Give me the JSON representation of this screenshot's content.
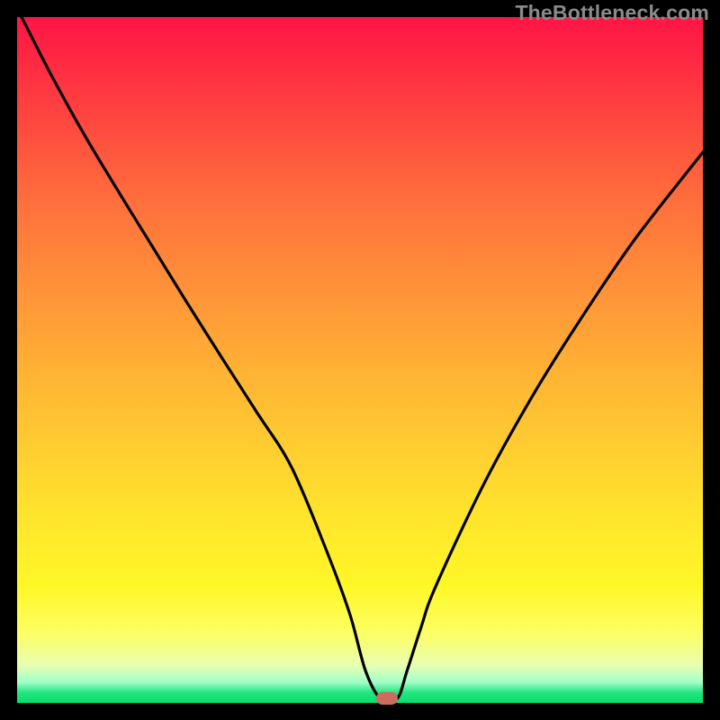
{
  "watermark": "TheBottleneck.com",
  "colors": {
    "frame": "#000000",
    "marker": "#cf6a5e",
    "curve": "#000000"
  },
  "chart_data": {
    "type": "line",
    "title": "",
    "xlabel": "",
    "ylabel": "",
    "xlim": [
      0,
      100
    ],
    "ylim": [
      0,
      100
    ],
    "grid": false,
    "legend": false,
    "series": [
      {
        "name": "bottleneck-curve",
        "x": [
          0.66,
          5,
          10,
          15,
          20,
          24.5,
          30,
          35,
          40,
          45,
          48.5,
          50.8,
          53.0,
          55.4,
          56.9,
          58.9,
          61,
          68,
          75,
          82,
          90,
          100
        ],
        "values": [
          100,
          91.5,
          82.5,
          74.2,
          66.1,
          58.8,
          50.1,
          42.3,
          34.4,
          22.5,
          13,
          4.7,
          0.6,
          0.6,
          4.8,
          11,
          16.9,
          31.8,
          44.5,
          55.7,
          67.5,
          80.3
        ]
      }
    ],
    "marker": {
      "x": 54.0,
      "y": 0.6
    },
    "gradient_stops": [
      {
        "pos": 0.0,
        "color": "#ff1545"
      },
      {
        "pos": 0.27,
        "color": "#ff6f3c"
      },
      {
        "pos": 0.64,
        "color": "#ffd030"
      },
      {
        "pos": 0.9,
        "color": "#fcff66"
      },
      {
        "pos": 0.985,
        "color": "#23e57e"
      },
      {
        "pos": 1.0,
        "color": "#00e16f"
      }
    ]
  }
}
